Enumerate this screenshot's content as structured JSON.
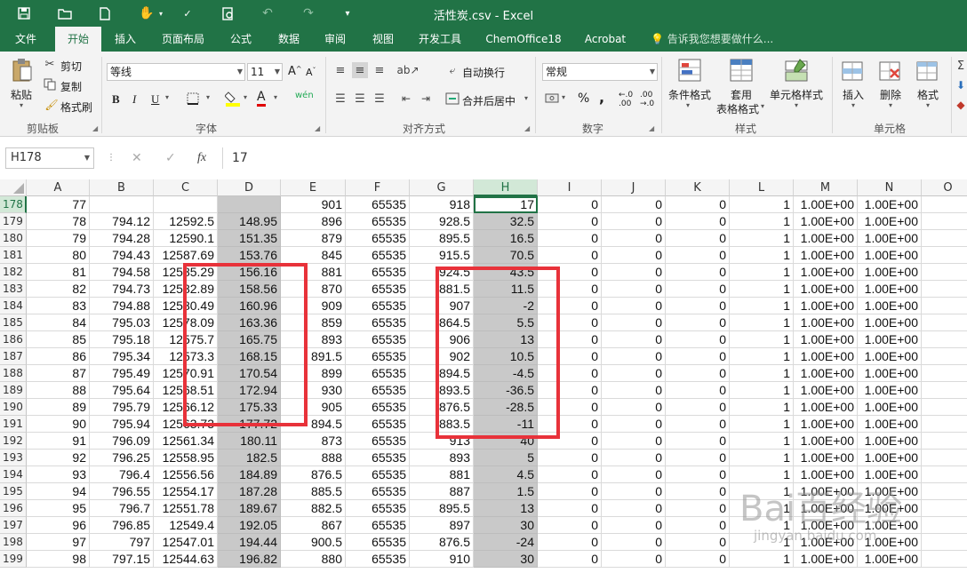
{
  "title_bar": {
    "title": "活性炭.csv - Excel",
    "icons": [
      "save-icon",
      "open-folder-icon",
      "new-file-icon",
      "touch-mode-icon",
      "spelling-icon",
      "print-preview-icon",
      "undo-icon",
      "redo-icon",
      "customize-qat-icon"
    ]
  },
  "tabs": [
    "文件",
    "开始",
    "插入",
    "页面布局",
    "公式",
    "数据",
    "审阅",
    "视图",
    "开发工具",
    "ChemOffice18",
    "Acrobat"
  ],
  "active_tab": "开始",
  "tell_me": "告诉我您想要做什么...",
  "ribbon": {
    "clipboard": {
      "paste": "粘贴",
      "cut": "剪切",
      "copy": "复制",
      "format_painter": "格式刷",
      "label": "剪贴板"
    },
    "font": {
      "name": "等线",
      "size": "11",
      "grow": "A",
      "shrink": "A",
      "bold": "B",
      "italic": "I",
      "underline": "U",
      "font_color": "A",
      "phonetic": "wén",
      "label": "字体"
    },
    "alignment": {
      "wrap": "自动换行",
      "merge": "合并后居中",
      "label": "对齐方式"
    },
    "number": {
      "format": "常规",
      "percent": "%",
      "comma": ",",
      "inc_decimal": "←.0 .00",
      "dec_decimal": ".00 →.0",
      "label": "数字"
    },
    "styles": {
      "conditional": "条件格式",
      "table_line1": "套用",
      "table_line2": "表格格式",
      "cell_styles": "单元格样式",
      "label": "样式"
    },
    "cells": {
      "insert": "插入",
      "delete": "删除",
      "format": "格式",
      "label": "单元格"
    }
  },
  "formula_bar": {
    "name_box": "H178",
    "cancel": "✕",
    "enter": "✓",
    "fx": "fx",
    "value": "17"
  },
  "columns": [
    "A",
    "B",
    "C",
    "D",
    "E",
    "F",
    "G",
    "H",
    "I",
    "J",
    "K",
    "L",
    "M",
    "N",
    "O"
  ],
  "selected_column": "H",
  "selected_row": "178",
  "active_cell": "H178",
  "rows": [
    {
      "r": "178",
      "c": [
        "77",
        "",
        "",
        "",
        "901",
        "65535",
        "918",
        "17",
        "0",
        "0",
        "0",
        "1",
        "1.00E+00",
        "1.00E+00",
        ""
      ]
    },
    {
      "r": "179",
      "c": [
        "78",
        "794.12",
        "12592.5",
        "148.95",
        "896",
        "65535",
        "928.5",
        "32.5",
        "0",
        "0",
        "0",
        "1",
        "1.00E+00",
        "1.00E+00",
        ""
      ]
    },
    {
      "r": "180",
      "c": [
        "79",
        "794.28",
        "12590.1",
        "151.35",
        "879",
        "65535",
        "895.5",
        "16.5",
        "0",
        "0",
        "0",
        "1",
        "1.00E+00",
        "1.00E+00",
        ""
      ]
    },
    {
      "r": "181",
      "c": [
        "80",
        "794.43",
        "12587.69",
        "153.76",
        "845",
        "65535",
        "915.5",
        "70.5",
        "0",
        "0",
        "0",
        "1",
        "1.00E+00",
        "1.00E+00",
        ""
      ]
    },
    {
      "r": "182",
      "c": [
        "81",
        "794.58",
        "12585.29",
        "156.16",
        "881",
        "65535",
        "924.5",
        "43.5",
        "0",
        "0",
        "0",
        "1",
        "1.00E+00",
        "1.00E+00",
        ""
      ]
    },
    {
      "r": "183",
      "c": [
        "82",
        "794.73",
        "12582.89",
        "158.56",
        "870",
        "65535",
        "881.5",
        "11.5",
        "0",
        "0",
        "0",
        "1",
        "1.00E+00",
        "1.00E+00",
        ""
      ]
    },
    {
      "r": "184",
      "c": [
        "83",
        "794.88",
        "12580.49",
        "160.96",
        "909",
        "65535",
        "907",
        "-2",
        "0",
        "0",
        "0",
        "1",
        "1.00E+00",
        "1.00E+00",
        ""
      ]
    },
    {
      "r": "185",
      "c": [
        "84",
        "795.03",
        "12578.09",
        "163.36",
        "859",
        "65535",
        "864.5",
        "5.5",
        "0",
        "0",
        "0",
        "1",
        "1.00E+00",
        "1.00E+00",
        ""
      ]
    },
    {
      "r": "186",
      "c": [
        "85",
        "795.18",
        "12575.7",
        "165.75",
        "893",
        "65535",
        "906",
        "13",
        "0",
        "0",
        "0",
        "1",
        "1.00E+00",
        "1.00E+00",
        ""
      ]
    },
    {
      "r": "187",
      "c": [
        "86",
        "795.34",
        "12573.3",
        "168.15",
        "891.5",
        "65535",
        "902",
        "10.5",
        "0",
        "0",
        "0",
        "1",
        "1.00E+00",
        "1.00E+00",
        ""
      ]
    },
    {
      "r": "188",
      "c": [
        "87",
        "795.49",
        "12570.91",
        "170.54",
        "899",
        "65535",
        "894.5",
        "-4.5",
        "0",
        "0",
        "0",
        "1",
        "1.00E+00",
        "1.00E+00",
        ""
      ]
    },
    {
      "r": "189",
      "c": [
        "88",
        "795.64",
        "12568.51",
        "172.94",
        "930",
        "65535",
        "893.5",
        "-36.5",
        "0",
        "0",
        "0",
        "1",
        "1.00E+00",
        "1.00E+00",
        ""
      ]
    },
    {
      "r": "190",
      "c": [
        "89",
        "795.79",
        "12566.12",
        "175.33",
        "905",
        "65535",
        "876.5",
        "-28.5",
        "0",
        "0",
        "0",
        "1",
        "1.00E+00",
        "1.00E+00",
        ""
      ]
    },
    {
      "r": "191",
      "c": [
        "90",
        "795.94",
        "12563.73",
        "177.72",
        "894.5",
        "65535",
        "883.5",
        "-11",
        "0",
        "0",
        "0",
        "1",
        "1.00E+00",
        "1.00E+00",
        ""
      ]
    },
    {
      "r": "192",
      "c": [
        "91",
        "796.09",
        "12561.34",
        "180.11",
        "873",
        "65535",
        "913",
        "40",
        "0",
        "0",
        "0",
        "1",
        "1.00E+00",
        "1.00E+00",
        ""
      ]
    },
    {
      "r": "193",
      "c": [
        "92",
        "796.25",
        "12558.95",
        "182.5",
        "888",
        "65535",
        "893",
        "5",
        "0",
        "0",
        "0",
        "1",
        "1.00E+00",
        "1.00E+00",
        ""
      ]
    },
    {
      "r": "194",
      "c": [
        "93",
        "796.4",
        "12556.56",
        "184.89",
        "876.5",
        "65535",
        "881",
        "4.5",
        "0",
        "0",
        "0",
        "1",
        "1.00E+00",
        "1.00E+00",
        ""
      ]
    },
    {
      "r": "195",
      "c": [
        "94",
        "796.55",
        "12554.17",
        "187.28",
        "885.5",
        "65535",
        "887",
        "1.5",
        "0",
        "0",
        "0",
        "1",
        "1.00E+00",
        "1.00E+00",
        ""
      ]
    },
    {
      "r": "196",
      "c": [
        "95",
        "796.7",
        "12551.78",
        "189.67",
        "882.5",
        "65535",
        "895.5",
        "13",
        "0",
        "0",
        "0",
        "1",
        "1.00E+00",
        "1.00E+00",
        ""
      ]
    },
    {
      "r": "197",
      "c": [
        "96",
        "796.85",
        "12549.4",
        "192.05",
        "867",
        "65535",
        "897",
        "30",
        "0",
        "0",
        "0",
        "1",
        "1.00E+00",
        "1.00E+00",
        ""
      ]
    },
    {
      "r": "198",
      "c": [
        "97",
        "797",
        "12547.01",
        "194.44",
        "900.5",
        "65535",
        "876.5",
        "-24",
        "0",
        "0",
        "0",
        "1",
        "1.00E+00",
        "1.00E+00",
        ""
      ]
    },
    {
      "r": "199",
      "c": [
        "98",
        "797.15",
        "12544.63",
        "196.82",
        "880",
        "65535",
        "910",
        "30",
        "0",
        "0",
        "0",
        "1",
        "1.00E+00",
        "1.00E+00",
        ""
      ]
    }
  ],
  "annotations": {
    "highlight_color": "#e8323a",
    "highlight_ranges": [
      "D182:D191",
      "H182:H191"
    ]
  },
  "watermark": {
    "main": "Bai百经验",
    "sub": "jingyan.baidu.com"
  },
  "colors": {
    "excel_green": "#217346",
    "shaded_column": "#c9c9c9",
    "header_bg": "#f5f5f5"
  }
}
